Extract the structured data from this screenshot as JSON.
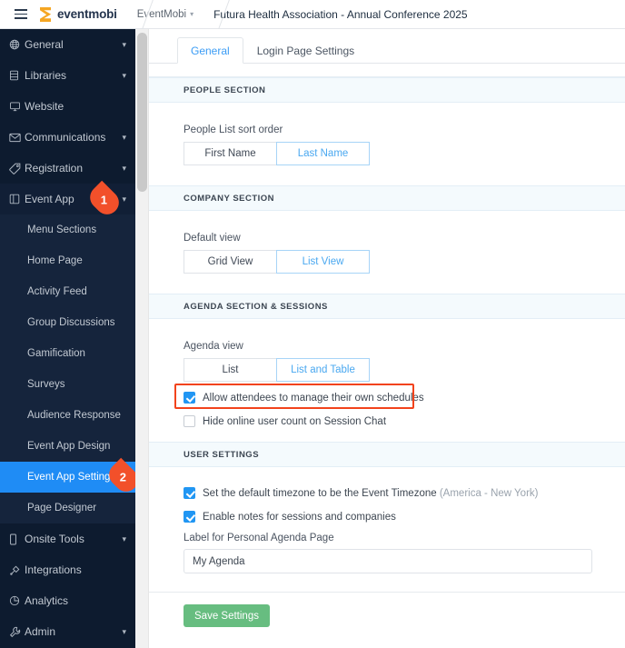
{
  "topbar": {
    "menu_icon": "hamburger-icon",
    "logo_text": "eventmobi",
    "breadcrumb": [
      {
        "label": "EventMobi",
        "has_chevron": true
      },
      {
        "label": "Futura Health Association - Annual Conference 2025",
        "has_chevron": false
      }
    ]
  },
  "sidebar": {
    "items": [
      {
        "label": "General",
        "icon": "globe-icon",
        "chevron": "⌄"
      },
      {
        "label": "Libraries",
        "icon": "library-icon",
        "chevron": "⌄"
      },
      {
        "label": "Website",
        "icon": "monitor-icon",
        "chevron": ""
      },
      {
        "label": "Communications",
        "icon": "envelope-icon",
        "chevron": "⌄"
      },
      {
        "label": "Registration",
        "icon": "tag-icon",
        "chevron": "⌄"
      },
      {
        "label": "Event App",
        "icon": "app-grid-icon",
        "chevron": "⌄",
        "badge": "1"
      }
    ],
    "event_app_subitems": [
      {
        "label": "Menu Sections"
      },
      {
        "label": "Home Page"
      },
      {
        "label": "Activity Feed"
      },
      {
        "label": "Group Discussions"
      },
      {
        "label": "Gamification"
      },
      {
        "label": "Surveys"
      },
      {
        "label": "Audience Response"
      },
      {
        "label": "Event App Design"
      },
      {
        "label": "Event App Settings",
        "selected": true,
        "badge": "2"
      },
      {
        "label": "Page Designer"
      }
    ],
    "items_bottom": [
      {
        "label": "Onsite Tools",
        "icon": "mobile-icon",
        "chevron": "⌄"
      },
      {
        "label": "Integrations",
        "icon": "plug-icon",
        "chevron": ""
      },
      {
        "label": "Analytics",
        "icon": "pie-chart-icon",
        "chevron": ""
      },
      {
        "label": "Admin",
        "icon": "wrench-icon",
        "chevron": "⌄"
      }
    ],
    "colors": {
      "bg": "#0d1b2f",
      "selected": "#1f8cf5",
      "badge": "#f2502a"
    }
  },
  "main": {
    "tabs": [
      {
        "label": "General",
        "active": true
      },
      {
        "label": "Login Page Settings",
        "active": false
      }
    ],
    "sections": [
      {
        "heading": "PEOPLE SECTION",
        "field_label": "People List sort order",
        "options": [
          {
            "label": "First Name",
            "selected": false
          },
          {
            "label": "Last Name",
            "selected": true
          }
        ]
      },
      {
        "heading": "COMPANY SECTION",
        "field_label": "Default view",
        "options": [
          {
            "label": "Grid View",
            "selected": false
          },
          {
            "label": "List View",
            "selected": true
          }
        ]
      },
      {
        "heading": "AGENDA SECTION & SESSIONS",
        "field_label": "Agenda view",
        "options": [
          {
            "label": "List",
            "selected": false
          },
          {
            "label": "List and Table",
            "selected": true
          }
        ],
        "checkboxes": [
          {
            "label": "Allow attendees to manage their own schedules",
            "checked": true,
            "highlighted": true
          },
          {
            "label": "Hide online user count on Session Chat",
            "checked": false,
            "highlighted": false
          }
        ]
      },
      {
        "heading": "USER SETTINGS",
        "checkboxes": [
          {
            "label": "Set the default timezone to be the Event Timezone",
            "suffix": "(America - New York)",
            "checked": true
          },
          {
            "label": "Enable notes for sessions and companies",
            "checked": true
          }
        ],
        "input_label": "Label for Personal Agenda Page",
        "input_value": "My Agenda",
        "input_placeholder": "My Agenda"
      }
    ],
    "save_button": "Save Settings",
    "colors": {
      "accent": "#3b9cf5",
      "save": "#67bd80",
      "highlight": "#f2431c"
    }
  }
}
